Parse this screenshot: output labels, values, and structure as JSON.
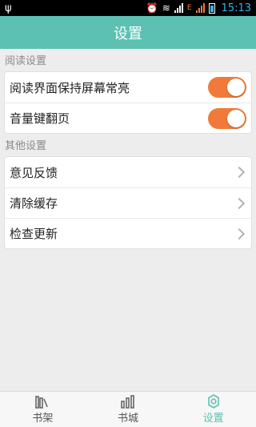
{
  "status_bar": {
    "time": "15:13",
    "usb_icon": "usb-icon",
    "alarm_icon": "alarm-icon",
    "wifi_icon": "wifi-icon",
    "battery_icon": "battery-icon",
    "data_badge": "E"
  },
  "header": {
    "title": "设置"
  },
  "sections": [
    {
      "title": "阅读设置",
      "items": [
        {
          "label": "阅读界面保持屏幕常亮",
          "control": "toggle",
          "on": true
        },
        {
          "label": "音量键翻页",
          "control": "toggle",
          "on": true
        }
      ]
    },
    {
      "title": "其他设置",
      "items": [
        {
          "label": "意见反馈",
          "control": "chevron"
        },
        {
          "label": "清除缓存",
          "control": "chevron"
        },
        {
          "label": "检查更新",
          "control": "chevron"
        }
      ]
    }
  ],
  "tabs": [
    {
      "label": "书架",
      "icon": "bookshelf-icon",
      "active": false
    },
    {
      "label": "书城",
      "icon": "bookstore-icon",
      "active": false
    },
    {
      "label": "设置",
      "icon": "settings-gear-icon",
      "active": true
    }
  ],
  "colors": {
    "primary": "#5cc1b3",
    "toggle_on": "#f07a3a",
    "background": "#ededed"
  }
}
